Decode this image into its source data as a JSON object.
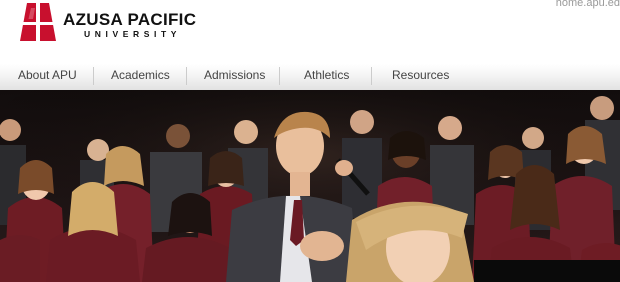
{
  "brand": {
    "name": "AZUSA PACIFIC",
    "subname": "UNIVERSITY",
    "logo_icon": "apu-shield-logo",
    "brand_color": "#c8102e"
  },
  "top_link": "home.apu.ed",
  "nav": {
    "items": [
      {
        "label": "About APU"
      },
      {
        "label": "Academics"
      },
      {
        "label": "Admissions"
      },
      {
        "label": "Athletics"
      },
      {
        "label": "Resources"
      }
    ]
  },
  "hero": {
    "description_icon": "choir-photo",
    "robe_color": "#6e1c24"
  }
}
